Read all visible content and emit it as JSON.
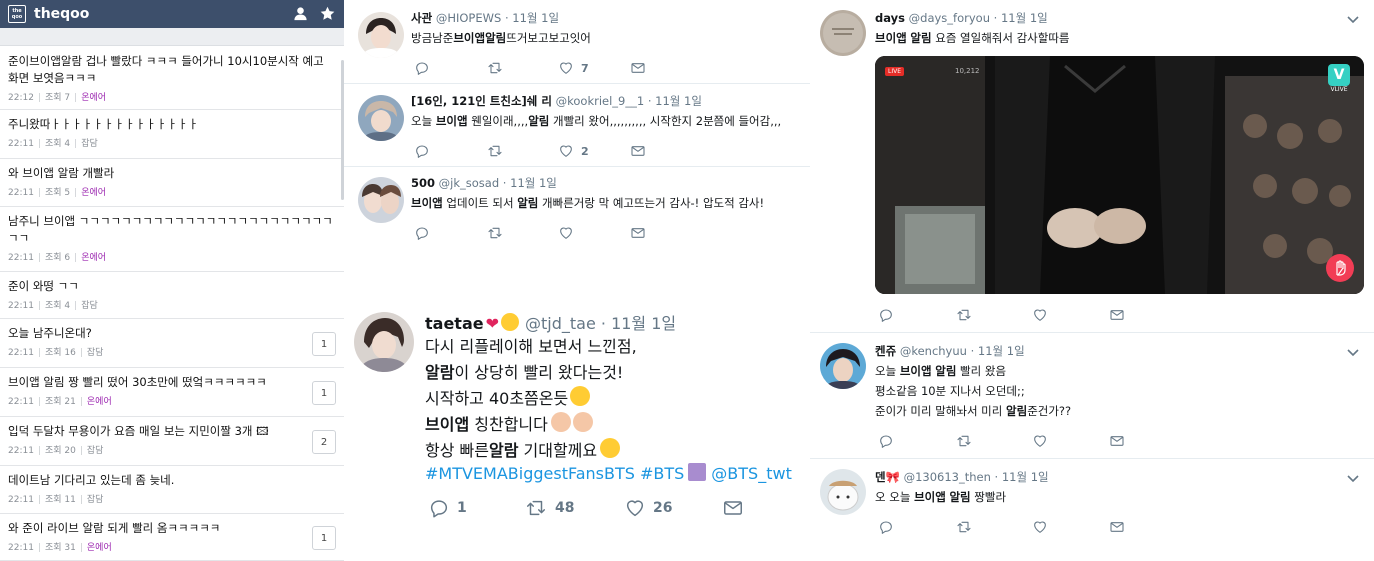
{
  "theqoo": {
    "title": "theqoo",
    "logo_top": "the",
    "logo_bottom": "qoo",
    "posts": [
      {
        "title_lines": [
          "준이브이앱알람 겁나 빨랐다 ㅋㅋㅋ 들어가니 10시10분시작 예고",
          "화면 보엿음ㅋㅋㅋ"
        ],
        "time": "22:12",
        "views": "조회 7",
        "category": "온에어",
        "comments": ""
      },
      {
        "title_lines": [
          "주니왔따ㅏㅏㅏㅏㅏㅏㅏㅏㅏㅏㅏㅏㅏㅏ"
        ],
        "time": "22:11",
        "views": "조회 4",
        "category": "잡담",
        "comments": ""
      },
      {
        "title_lines": [
          "와 브이앱 알람 개빨라"
        ],
        "time": "22:11",
        "views": "조회 5",
        "category": "온에어",
        "comments": ""
      },
      {
        "title_lines": [
          "남주니 브이앱 ㄱㄱㄱㄱㄱㄱㄱㄱㄱㄱㄱㄱㄱㄱㄱㄱㄱㄱㄱㄱㄱㄱㄱㄱ",
          "ㄱㄱ"
        ],
        "time": "22:11",
        "views": "조회 6",
        "category": "온에어",
        "comments": ""
      },
      {
        "title_lines": [
          "준이 와떵 ㄱㄱ"
        ],
        "time": "22:11",
        "views": "조회 4",
        "category": "잡담",
        "comments": ""
      },
      {
        "title_lines": [
          "오늘 남주니온대?"
        ],
        "time": "22:11",
        "views": "조회 16",
        "category": "잡담",
        "comments": "1"
      },
      {
        "title_lines": [
          "브이앱 알림 짱 빨리 떴어 30초만에 떴엌ㅋㅋㅋㅋㅋㅋ"
        ],
        "time": "22:11",
        "views": "조회 21",
        "category": "온에어",
        "comments": "1"
      },
      {
        "title_lines": [
          "입덕 두달차 무용이가 요즘 매일 보는 지민이짤 3개 🖾"
        ],
        "time": "22:11",
        "views": "조회 20",
        "category": "잡담",
        "comments": "2"
      },
      {
        "title_lines": [
          "데이트남 기다리고 있는데 좀 늦네."
        ],
        "time": "22:11",
        "views": "조회 11",
        "category": "잡담",
        "comments": ""
      },
      {
        "title_lines": [
          "와 준이 라이브 알람 되게 빨리 옴ㅋㅋㅋㅋㅋ"
        ],
        "time": "22:11",
        "views": "조회 31",
        "category": "온에어",
        "comments": "1"
      }
    ]
  },
  "middle_tweets": [
    {
      "name": "사관",
      "handle": "@HIOPEWS",
      "date": "11월 1일",
      "text": "방금남준브이앱알림뜨거보고보고잇어",
      "reply": "",
      "retweet": "",
      "like": "7"
    },
    {
      "name": "[16인, 121인 트친소]쉐 리",
      "handle": "@kookriel_9__1",
      "date": "11월 1일",
      "text": "오늘 브이앱 웬일이래,,,,알림 개빨리 왔어,,,,,,,,,, 시작한지 2분쯤에 들어감,,,",
      "reply": "",
      "retweet": "",
      "like": "2"
    },
    {
      "name": "500",
      "handle": "@jk_sosad",
      "date": "11월 1일",
      "text": "브이앱 업데이트 되서 알림 개빠른거랑 막 예고뜨는거 감사-! 압도적 감사!",
      "reply": "",
      "retweet": "",
      "like": ""
    }
  ],
  "big_tweet": {
    "name": "taetae",
    "handle": "@tjd_tae",
    "date": "11월 1일",
    "lines": [
      "다시 리플레이해 보면서 느낀점,",
      "알람이 상당히 빨리 왔다는것!",
      "시작하고 40초쯤온듯",
      "브이앱 칭찬합니다",
      "항상 빠른알람 기대할께요"
    ],
    "hashtags": "#MTVEMABiggestFansBTS #BTS",
    "mention": "@BTS_twt",
    "reply": "1",
    "retweet": "48",
    "like": "26"
  },
  "right_tweets": [
    {
      "name": "days",
      "handle": "@days_foryou",
      "date": "11월 1일",
      "lines": [
        "브이앱 알림 요즘 열일해줘서 감사할따름"
      ]
    },
    {
      "name": "켄쥬",
      "handle": "@kenchyuu",
      "date": "11월 1일",
      "lines": [
        "오늘 브이앱 알림 빨리 왔음",
        "평소같음 10분 지나서 오던데;;",
        "준이가 미리 말해놔서 미리 알림준건가??"
      ]
    },
    {
      "name": "덴🎀",
      "handle": "@130613_then",
      "date": "11월 1일",
      "lines": [
        "오 오늘 브이앱 알림 짱빨라"
      ]
    }
  ],
  "video": {
    "live": "LIVE",
    "viewers": "10,212",
    "brand": "VLIVE"
  },
  "colors": {
    "theqoo_header": "#3d4f6b",
    "onair": "#9c27b0",
    "link_blue": "#1b95e0",
    "gray_text": "#657786"
  }
}
